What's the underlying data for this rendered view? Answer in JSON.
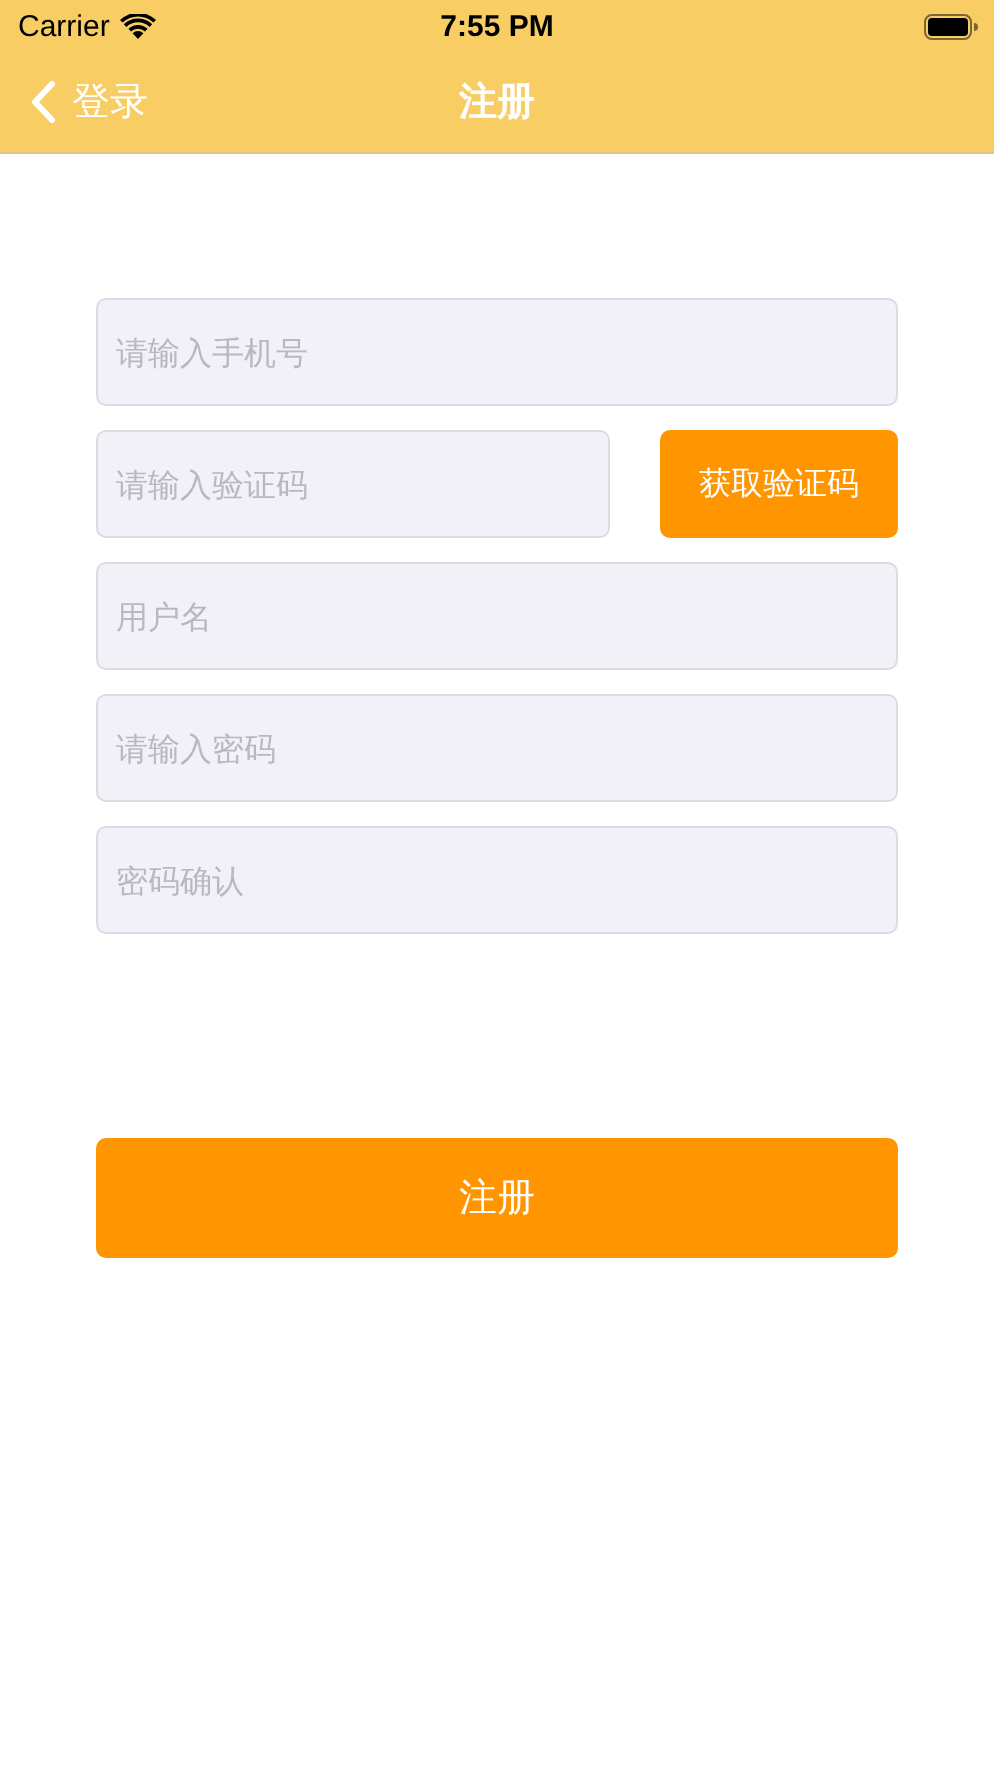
{
  "status_bar": {
    "carrier": "Carrier",
    "time": "7:55 PM"
  },
  "nav": {
    "back": "登录",
    "title": "注册"
  },
  "fields": [
    {
      "kind": "plain",
      "placeholder": "请输入手机号"
    },
    {
      "kind": "code",
      "placeholder": "请输入验证码",
      "button": "获取验证码"
    },
    {
      "kind": "plain",
      "placeholder": "用户名"
    },
    {
      "kind": "password",
      "placeholder": "请输入密码"
    },
    {
      "kind": "password",
      "placeholder": "密码确认"
    }
  ],
  "submit": "注册"
}
